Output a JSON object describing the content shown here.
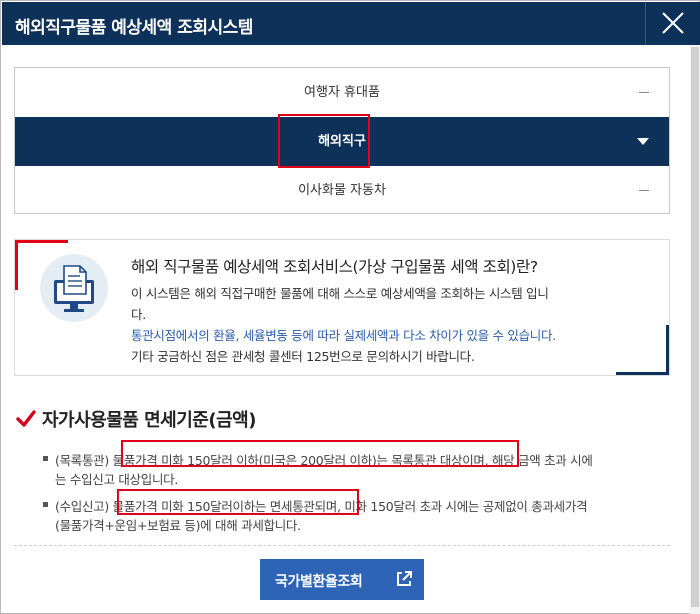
{
  "window": {
    "title": "해외직구물품 예상세액 조회시스템"
  },
  "menu": {
    "items": [
      {
        "label": "여행자 휴대품",
        "state": "collapsed"
      },
      {
        "label": "해외직구",
        "state": "expanded"
      },
      {
        "label": "이사화물 자동차",
        "state": "collapsed"
      }
    ]
  },
  "info": {
    "title": "해외 직구물품 예상세액 조회서비스(가상 구입물품 세액 조회)란?",
    "line1": "이 시스템은 해외 직접구매한 물품에 대해 스스로 예상세액을 조회하는 시스템 입니",
    "line2": "다.",
    "line3": "통관시점에서의 환율, 세율변동 등에 따라 실제세액과 다소 차이가 있을 수 있습니다.",
    "line4": "기타 궁금하신 점은 관세청 콜센터 125번으로 문의하시기 바랍니다."
  },
  "section": {
    "title": "자가사용물품 면세기준(금액)",
    "bullets": [
      {
        "line1": "(목록통관) 물품가격 미화 150달러 이하(미국은 200달러 이하)는 목록통관 대상이며, 해당 금액 초과 시에",
        "line2": "는 수입신고 대상입니다."
      },
      {
        "line1": "(수입신고) 물품가격 미화 150달러이하는 면세통관되며, 미화 150달러 초과 시에는 공제없이 총과세가격",
        "line2": "(물품가격+운임+보험료 등)에 대해 과세합니다."
      }
    ]
  },
  "button": {
    "label": "국가별환율조회"
  },
  "colors": {
    "navy": "#0d3158",
    "accent_red": "#e0001a",
    "button_blue": "#2d64b5",
    "notice_blue": "#2a5caa"
  }
}
